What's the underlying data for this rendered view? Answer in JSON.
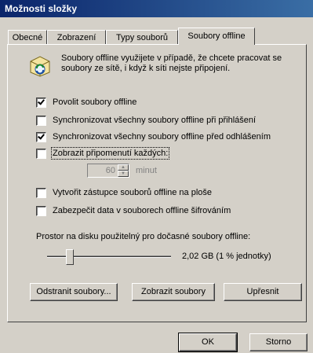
{
  "window": {
    "title": "Možnosti složky"
  },
  "tabs": [
    {
      "label": "Obecné"
    },
    {
      "label": "Zobrazení"
    },
    {
      "label": "Typy souborů"
    },
    {
      "label": "Soubory offline"
    }
  ],
  "info": {
    "text": "Soubory offline využijete v případě, že chcete pracovat se soubory ze sítě, i když k síti nejste připojení.",
    "icon": "offline-files-sync-icon"
  },
  "options": [
    {
      "label": "Povolit soubory offline",
      "checked": true
    },
    {
      "label": "Synchronizovat všechny soubory offline při přihlášení",
      "checked": false
    },
    {
      "label": "Synchronizovat všechny soubory offline před odhlášením",
      "checked": true
    },
    {
      "label": "Zobrazit připomenutí každých:",
      "checked": false
    }
  ],
  "reminder": {
    "value": "60",
    "unit": "minut"
  },
  "options2": [
    {
      "label": "Vytvořit zástupce souborů offline na ploše",
      "checked": false
    },
    {
      "label": "Zabezpečit data v souborech offline šifrováním",
      "checked": false
    }
  ],
  "disk": {
    "label": "Prostor na disku použitelný pro dočasné soubory offline:",
    "value_text": "2,02 GB (1 % jednotky)",
    "percent": 1
  },
  "actions": {
    "delete": "Odstranit soubory...",
    "view": "Zobrazit soubory",
    "advanced": "Upřesnit"
  },
  "dialog": {
    "ok": "OK",
    "cancel": "Storno"
  }
}
